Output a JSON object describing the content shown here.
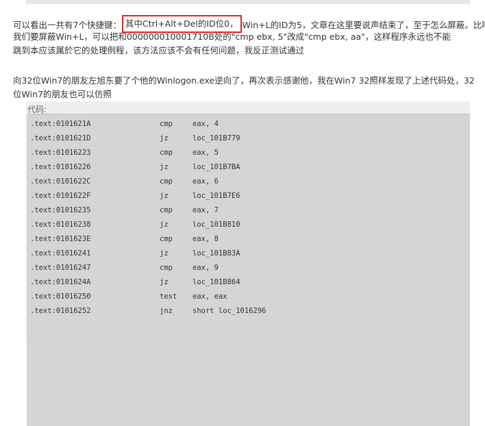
{
  "para1": {
    "line1_pre": "可以看出一共有7个快捷键：",
    "line1_highlight": "其中Ctrl+Alt+Del的ID位0，",
    "line1_post": "Win+L的ID为5，文章在这里要说声结束了，至于怎么屏蔽。比喻",
    "line2": "我们要屏蔽Win+L，可以把和000000010001710B处的\"cmp     ebx, 5\"改成\"cmp     ebx, aa\"，这样程序永远也不能",
    "line3": "跳到本应该属於它的处理例程，该方法应该不会有任何问题，我反正测试通过"
  },
  "para2": {
    "line1": "向32位Win7的朋友左旭东要了个他的Winlogon.exe逆向了，再次表示感谢他，我在Win7 32照样发现了上述代码处，32",
    "line2": "位Win7的朋友也可以仿照"
  },
  "code": {
    "label": "代码:",
    "rows": [
      {
        "addr": ".text:0101621A",
        "op": "cmp",
        "arg": "eax, 4"
      },
      {
        "addr": ".text:0101621D",
        "op": "jz",
        "arg": "loc_101B779"
      },
      {
        "addr": ".text:01016223",
        "op": "cmp",
        "arg": "eax, 5"
      },
      {
        "addr": ".text:01016226",
        "op": "jz",
        "arg": "loc_101B7BA"
      },
      {
        "addr": ".text:0101622C",
        "op": "cmp",
        "arg": "eax, 6"
      },
      {
        "addr": ".text:0101622F",
        "op": "jz",
        "arg": "loc_101B7E6"
      },
      {
        "addr": ".text:01016235",
        "op": "cmp",
        "arg": "eax, 7"
      },
      {
        "addr": ".text:01016238",
        "op": "jz",
        "arg": "loc_101B810"
      },
      {
        "addr": ".text:0101623E",
        "op": "cmp",
        "arg": "eax, 8"
      },
      {
        "addr": ".text:01016241",
        "op": "jz",
        "arg": "loc_101B83A"
      },
      {
        "addr": ".text:01016247",
        "op": "cmp",
        "arg": "eax, 9"
      },
      {
        "addr": ".text:0101624A",
        "op": "jz",
        "arg": "loc_101B864"
      },
      {
        "addr": ".text:01016250",
        "op": "test",
        "arg": "eax, eax"
      },
      {
        "addr": ".text:01016252",
        "op": "jnz",
        "arg": "short loc_1016296"
      }
    ]
  },
  "colors": {
    "highlight_border": "#e0242a",
    "code_background": "#d5d5d5",
    "code_wrapper": "#efefef"
  }
}
